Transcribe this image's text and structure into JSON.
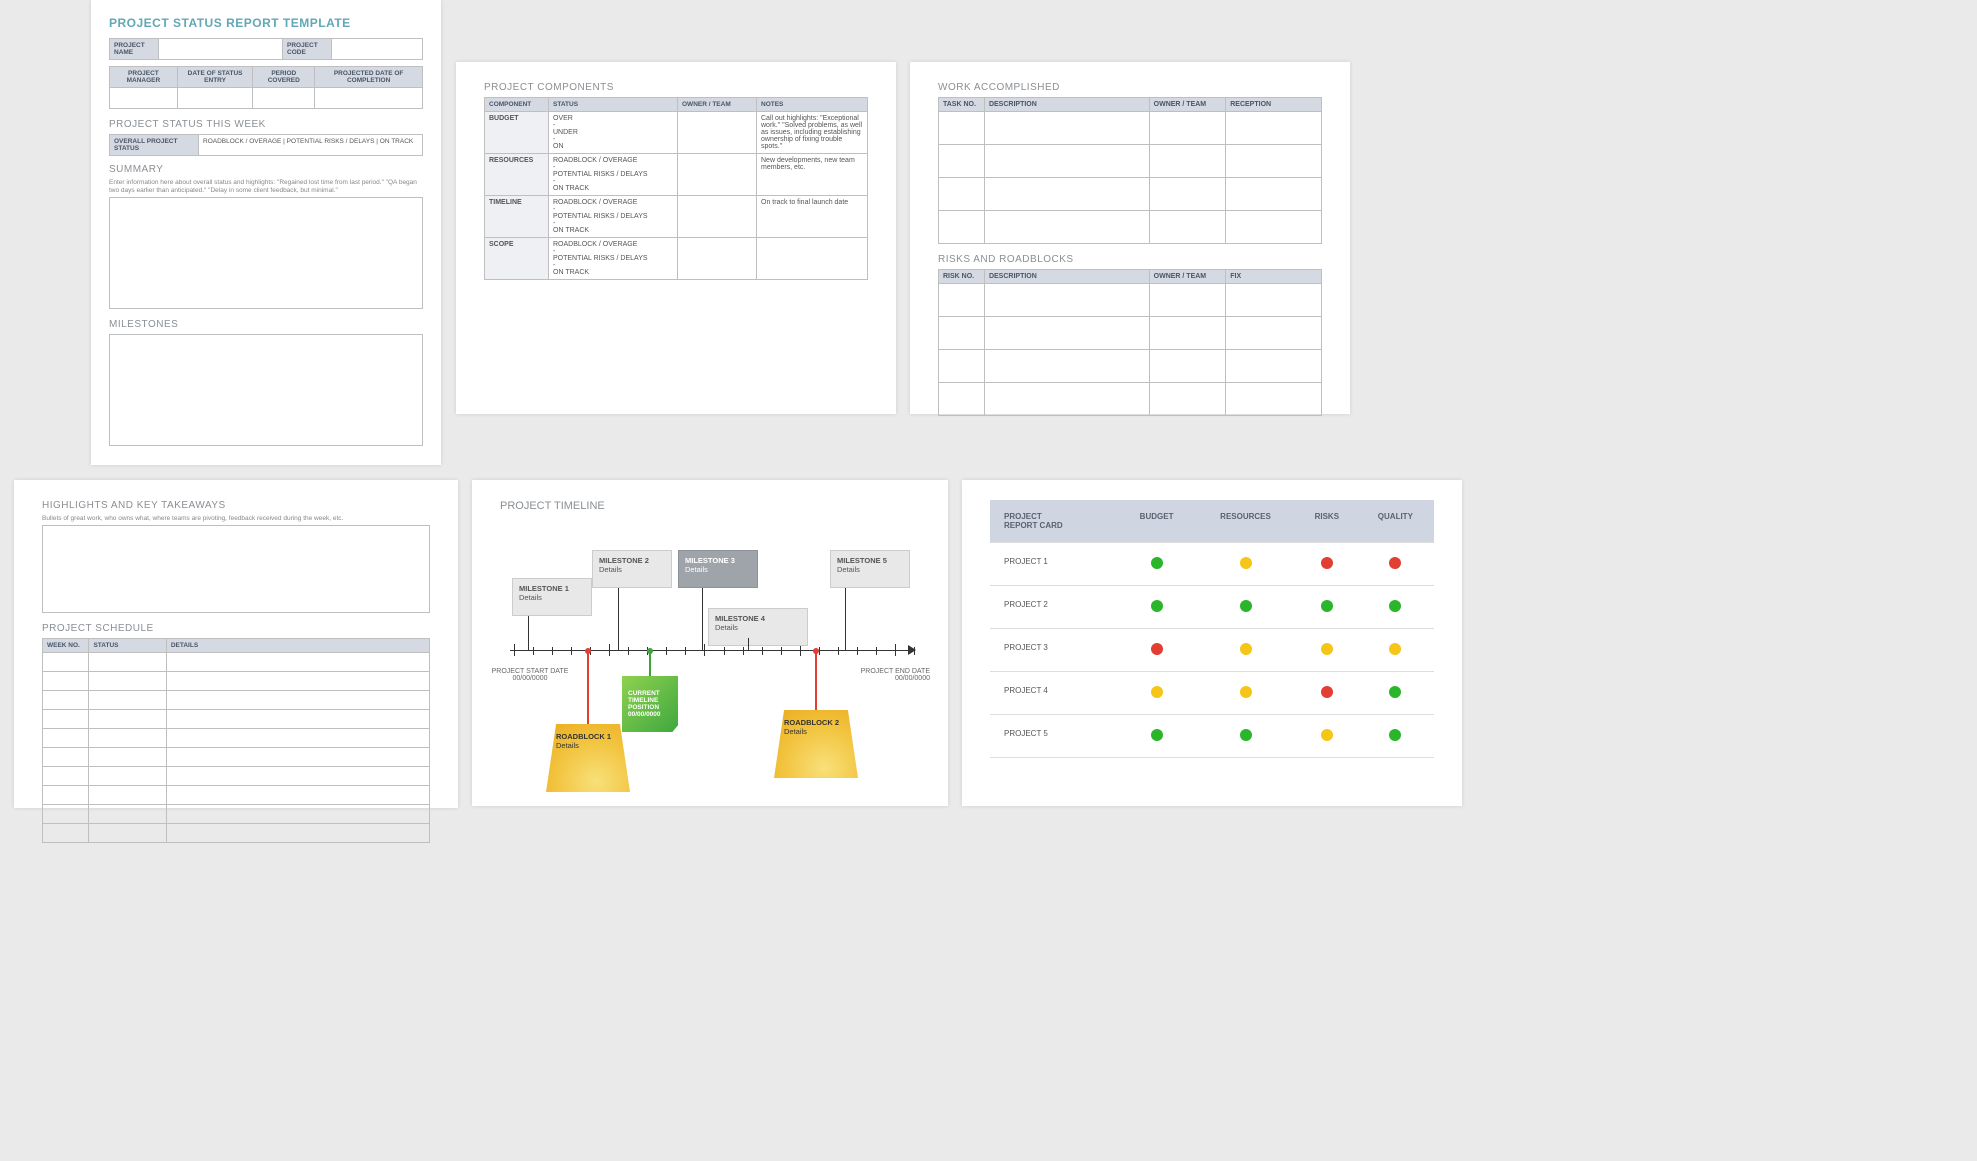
{
  "p1": {
    "title": "PROJECT STATUS REPORT TEMPLATE",
    "header_cells": [
      "PROJECT NAME",
      "PROJECT CODE"
    ],
    "row2": [
      "PROJECT MANAGER",
      "DATE OF STATUS ENTRY",
      "PERIOD COVERED",
      "PROJECTED DATE OF COMPLETION"
    ],
    "status_week_title": "PROJECT STATUS THIS WEEK",
    "status_label": "OVERALL PROJECT STATUS",
    "status_options": "ROADBLOCK / OVERAGE   |   POTENTIAL RISKS / DELAYS   |   ON TRACK",
    "summary_title": "SUMMARY",
    "summary_hint": "Enter information here about overall status and highlights: \"Regained lost time from last period.\" \"QA began two days earlier than anticipated.\" \"Delay in some client feedback, but minimal.\"",
    "milestones_title": "MILESTONES"
  },
  "p2": {
    "title": "PROJECT COMPONENTS",
    "headers": [
      "COMPONENT",
      "STATUS",
      "OWNER / TEAM",
      "NOTES"
    ],
    "rows": [
      {
        "label": "BUDGET",
        "status": "OVER\n-\nUNDER\n-\nON",
        "notes": "Call out highlights: \"Exceptional work.\" \"Solved problems, as well as issues, including establishing ownership of fixing trouble spots.\""
      },
      {
        "label": "RESOURCES",
        "status": "ROADBLOCK / OVERAGE\n-\nPOTENTIAL RISKS / DELAYS\n-\nON TRACK",
        "notes": "New developments, new team members, etc."
      },
      {
        "label": "TIMELINE",
        "status": "ROADBLOCK / OVERAGE\n-\nPOTENTIAL RISKS / DELAYS\n-\nON TRACK",
        "notes": "On track to final launch date"
      },
      {
        "label": "SCOPE",
        "status": "ROADBLOCK / OVERAGE\n-\nPOTENTIAL RISKS / DELAYS\n-\nON TRACK",
        "notes": ""
      }
    ]
  },
  "p3": {
    "work_title": "WORK ACCOMPLISHED",
    "work_headers": [
      "TASK NO.",
      "DESCRIPTION",
      "OWNER / TEAM",
      "RECEPTION"
    ],
    "work_rows": 4,
    "risks_title": "RISKS AND ROADBLOCKS",
    "risks_headers": [
      "RISK NO.",
      "DESCRIPTION",
      "OWNER / TEAM",
      "FIX"
    ],
    "risks_rows": 4
  },
  "p4": {
    "title": "HIGHLIGHTS AND KEY TAKEAWAYS",
    "hint": "Bullets of great work, who owns what, where teams are pivoting, feedback received during the week, etc.",
    "sched_title": "PROJECT SCHEDULE",
    "sched_headers": [
      "WEEK NO.",
      "STATUS",
      "DETAILS"
    ],
    "sched_rows": 10
  },
  "p5": {
    "title": "PROJECT TIMELINE",
    "ms": [
      {
        "t": "MILESTONE 1",
        "d": "Details"
      },
      {
        "t": "MILESTONE 2",
        "d": "Details"
      },
      {
        "t": "MILESTONE 3",
        "d": "Details"
      },
      {
        "t": "MILESTONE 4",
        "d": "Details"
      },
      {
        "t": "MILESTONE 5",
        "d": "Details"
      }
    ],
    "start": {
      "l": "PROJECT START DATE",
      "d": "00/00/0000"
    },
    "end": {
      "l": "PROJECT END DATE",
      "d": "00/00/0000"
    },
    "cur": {
      "l1": "CURRENT",
      "l2": "TIMELINE",
      "l3": "POSITION",
      "d": "00/00/0000"
    },
    "rb": [
      {
        "t": "ROADBLOCK 1",
        "d": "Details"
      },
      {
        "t": "ROADBLOCK 2",
        "d": "Details"
      }
    ]
  },
  "p6": {
    "title": "PROJECT REPORT CARD",
    "cols": [
      "BUDGET",
      "RESOURCES",
      "RISKS",
      "QUALITY"
    ],
    "rows": [
      {
        "name": "PROJECT 1",
        "v": [
          "g",
          "y",
          "r",
          "r"
        ]
      },
      {
        "name": "PROJECT 2",
        "v": [
          "g",
          "g",
          "g",
          "g"
        ]
      },
      {
        "name": "PROJECT 3",
        "v": [
          "r",
          "y",
          "y",
          "y"
        ]
      },
      {
        "name": "PROJECT 4",
        "v": [
          "y",
          "y",
          "r",
          "g"
        ]
      },
      {
        "name": "PROJECT 5",
        "v": [
          "g",
          "g",
          "y",
          "g"
        ]
      }
    ]
  }
}
